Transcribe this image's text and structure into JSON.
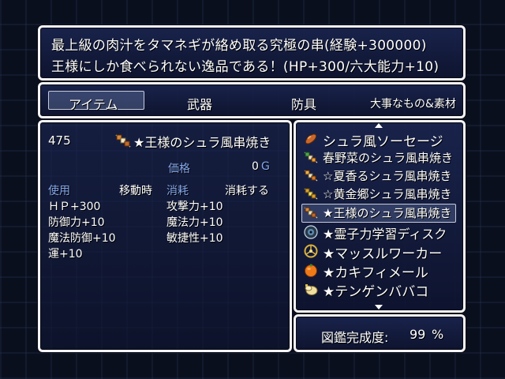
{
  "help": {
    "line1": "最上級の肉汁をタマネギが絡め取る究極の串(経験+300000)",
    "line2": "王様にしか食べられない逸品である！(HP+300/六大能力+10)"
  },
  "categories": [
    {
      "label": "アイテム",
      "selected": true
    },
    {
      "label": "武器"
    },
    {
      "label": "防具"
    },
    {
      "label": "大事なもの&素材"
    }
  ],
  "detail": {
    "count": "475",
    "item_icon": "skewer-icon",
    "item_name": "★王様のシュラ風串焼き",
    "price_label": "価格",
    "price_value": "0",
    "currency": "G",
    "use_label": "使用",
    "use_value": "移動時",
    "consume_label": "消耗",
    "consume_value": "消耗する",
    "effects_left": [
      "ＨＰ+300",
      "防御力+10",
      "魔法防御+10",
      "運+10"
    ],
    "effects_right": [
      "攻撃力+10",
      "魔法力+10",
      "敏捷性+10"
    ]
  },
  "item_list": {
    "items": [
      {
        "name": "シュラ風ソーセージ",
        "icon": "sausage-icon",
        "color": "#c9672a"
      },
      {
        "name": "春野菜のシュラ風串焼き",
        "icon": "skewer-icon",
        "color": "#e8a040"
      },
      {
        "name": "☆夏香るシュラ風串焼き",
        "icon": "skewer-icon",
        "color": "#e8b048"
      },
      {
        "name": "☆黄金郷シュラ風串焼き",
        "icon": "skewer-icon",
        "color": "#d8a030"
      },
      {
        "name": "★王様のシュラ風串焼き",
        "icon": "skewer-icon",
        "color": "#e8a040",
        "selected": true
      },
      {
        "name": "★霊子力学習ディスク",
        "icon": "disc-icon",
        "color": "#5a8ab0"
      },
      {
        "name": "★マッスルワーカー",
        "icon": "wheel-icon",
        "color": "#d8b040"
      },
      {
        "name": "★カキフィメール",
        "icon": "orange-fruit-icon",
        "color": "#f07a18"
      },
      {
        "name": "★テンゲンババコ",
        "icon": "bundle-icon",
        "color": "#e8d890"
      }
    ]
  },
  "completion": {
    "label": "図鑑完成度:",
    "value": "99",
    "unit": "%"
  }
}
